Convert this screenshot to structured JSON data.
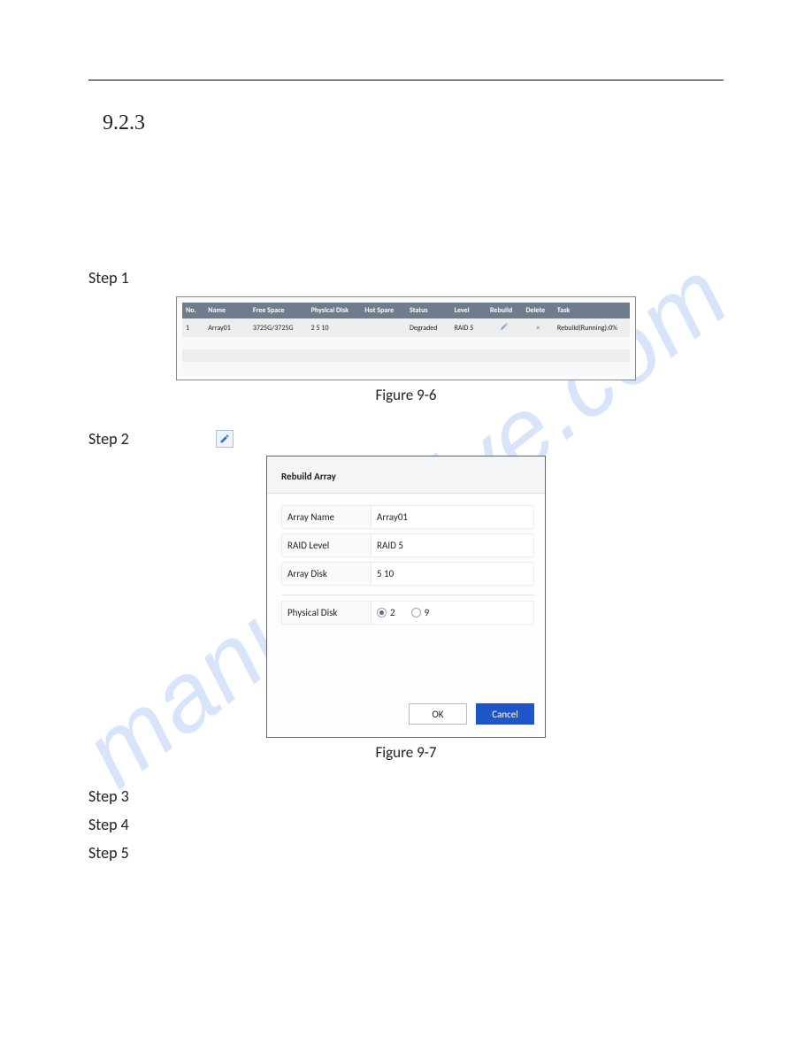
{
  "watermark": "manualshive.com",
  "section_number": "9.2.3",
  "steps": {
    "s1": "Step 1",
    "s2": "Step 2",
    "s3": "Step 3",
    "s4": "Step 4",
    "s5": "Step 5"
  },
  "figure96": {
    "caption": "Figure 9-6",
    "headers": {
      "no": "No.",
      "name": "Name",
      "free": "Free Space",
      "phys": "Physical Disk",
      "hot": "Hot Spare",
      "status": "Status",
      "level": "Level",
      "rebuild": "Rebuild",
      "delete": "Delete",
      "task": "Task"
    },
    "row": {
      "no": "1",
      "name": "Array01",
      "free": "3725G/3725G",
      "phys": "2  5  10",
      "hot": "",
      "status": "Degraded",
      "level": "RAID 5",
      "delete": "×",
      "task": "Rebuild(Running):0%"
    }
  },
  "figure97": {
    "caption": "Figure 9-7",
    "title": "Rebuild Array",
    "fields": {
      "array_name_label": "Array Name",
      "array_name_value": "Array01",
      "raid_level_label": "RAID Level",
      "raid_level_value": "RAID 5",
      "array_disk_label": "Array Disk",
      "array_disk_value": "5  10",
      "phys_disk_label": "Physical Disk",
      "phys_opt1": "2",
      "phys_opt2": "9"
    },
    "buttons": {
      "ok": "OK",
      "cancel": "Cancel"
    }
  },
  "icons": {
    "edit": "edit-icon"
  }
}
